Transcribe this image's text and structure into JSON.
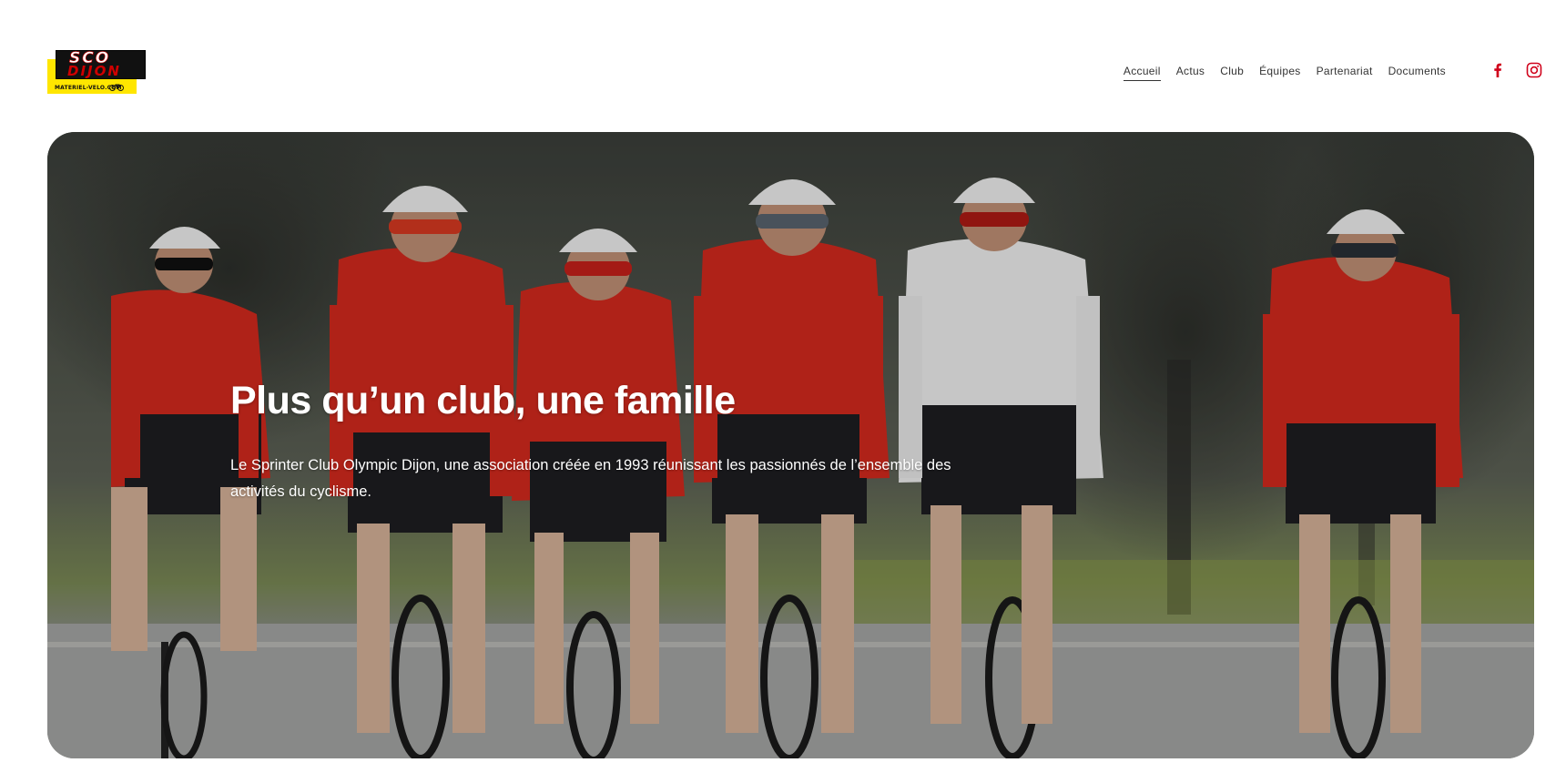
{
  "logo": {
    "line1": "SCO",
    "line2": "DIJON",
    "url": "MATERIEL-VELO.COM"
  },
  "nav": {
    "items": [
      "Accueil",
      "Actus",
      "Club",
      "Équipes",
      "Partenariat",
      "Documents"
    ],
    "active": "Accueil"
  },
  "social": {
    "icons": [
      "facebook-icon",
      "instagram-icon"
    ],
    "color": "#d0021b"
  },
  "hero": {
    "title": "Plus qu’un club, une famille",
    "text": "Le Sprinter Club Olympic Dijon, une association créée en 1993 réunissant les passionnés de l’ensemble des activités du cyclisme."
  },
  "colors": {
    "jersey_red": "#d62a1e",
    "jersey_white": "#f2f2f2",
    "accent": "#d0021b"
  }
}
